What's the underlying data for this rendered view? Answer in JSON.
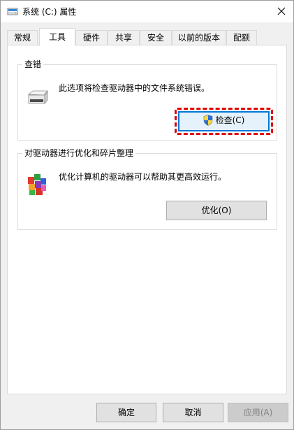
{
  "window": {
    "title": "系统 (C:) 属性",
    "close_icon": "close-icon",
    "drive_icon": "drive-icon"
  },
  "tabs": [
    {
      "label": "常规",
      "active": false
    },
    {
      "label": "工具",
      "active": true
    },
    {
      "label": "硬件",
      "active": false
    },
    {
      "label": "共享",
      "active": false
    },
    {
      "label": "安全",
      "active": false
    },
    {
      "label": "以前的版本",
      "active": false
    },
    {
      "label": "配额",
      "active": false
    }
  ],
  "error_check": {
    "title": "查错",
    "description": "此选项将检查驱动器中的文件系统错误。",
    "button_label": "检查(C)",
    "button_icon": "uac-shield-icon",
    "group_icon": "hard-drive-icon",
    "highlight_color": "#e00000"
  },
  "optimize": {
    "title": "对驱动器进行优化和碎片整理",
    "description": "优化计算机的驱动器可以帮助其更高效运行。",
    "button_label": "优化(O)",
    "group_icon": "defrag-icon"
  },
  "footer": {
    "ok_label": "确定",
    "cancel_label": "取消",
    "apply_label": "应用(A)"
  },
  "colors": {
    "accent": "#0078d7",
    "panel_bg": "#ffffff",
    "window_bg": "#f0f0f0"
  }
}
